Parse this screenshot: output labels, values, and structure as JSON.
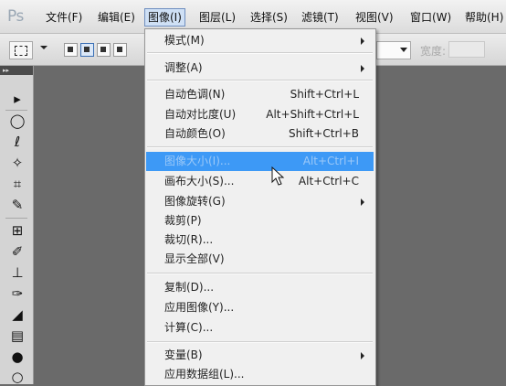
{
  "app": {
    "logo_text": "Ps"
  },
  "menubar": {
    "items": [
      {
        "label": "文件(F)"
      },
      {
        "label": "编辑(E)"
      },
      {
        "label": "图像(I)"
      },
      {
        "label": "图层(L)"
      },
      {
        "label": "选择(S)"
      },
      {
        "label": "滤镜(T)"
      },
      {
        "label": "视图(V)"
      },
      {
        "label": "窗口(W)"
      },
      {
        "label": "帮助(H)"
      }
    ],
    "active_index": 2
  },
  "options_bar": {
    "width_label": "宽度:"
  },
  "toolbox": {
    "collapse_glyph": "▸▸",
    "tools": [
      {
        "name": "move-tool-icon",
        "glyph": "▸"
      },
      {
        "name": "elliptical-marquee-tool-icon",
        "glyph": "◯"
      },
      {
        "name": "lasso-tool-icon",
        "glyph": "ℓ"
      },
      {
        "name": "magic-wand-tool-icon",
        "glyph": "✧"
      },
      {
        "name": "crop-tool-icon",
        "glyph": "⌗"
      },
      {
        "name": "eyedropper-tool-icon",
        "glyph": "✎"
      },
      {
        "name": "healing-brush-tool-icon",
        "glyph": "⊞"
      },
      {
        "name": "brush-tool-icon",
        "glyph": "✐"
      },
      {
        "name": "clone-stamp-tool-icon",
        "glyph": "⊥"
      },
      {
        "name": "history-brush-tool-icon",
        "glyph": "✑"
      },
      {
        "name": "eraser-tool-icon",
        "glyph": "◢"
      },
      {
        "name": "gradient-tool-icon",
        "glyph": "▤"
      },
      {
        "name": "blur-tool-icon",
        "glyph": "●"
      },
      {
        "name": "dodge-tool-icon",
        "glyph": "○"
      }
    ]
  },
  "image_menu": {
    "items": [
      {
        "label": "模式(M)",
        "shortcut": "",
        "submenu": true,
        "disabled": false
      },
      {
        "sep": true
      },
      {
        "label": "调整(A)",
        "shortcut": "",
        "submenu": true,
        "disabled": false
      },
      {
        "sep": true
      },
      {
        "label": "自动色调(N)",
        "shortcut": "Shift+Ctrl+L",
        "submenu": false,
        "disabled": false
      },
      {
        "label": "自动对比度(U)",
        "shortcut": "Alt+Shift+Ctrl+L",
        "submenu": false,
        "disabled": false
      },
      {
        "label": "自动颜色(O)",
        "shortcut": "Shift+Ctrl+B",
        "submenu": false,
        "disabled": false
      },
      {
        "sep": true
      },
      {
        "label": "图像大小(I)...",
        "shortcut": "Alt+Ctrl+I",
        "submenu": false,
        "disabled": false,
        "highlighted": true
      },
      {
        "label": "画布大小(S)...",
        "shortcut": "Alt+Ctrl+C",
        "submenu": false,
        "disabled": false
      },
      {
        "label": "图像旋转(G)",
        "shortcut": "",
        "submenu": true,
        "disabled": false
      },
      {
        "label": "裁剪(P)",
        "shortcut": "",
        "submenu": false,
        "disabled": false
      },
      {
        "label": "裁切(R)...",
        "shortcut": "",
        "submenu": false,
        "disabled": false
      },
      {
        "label": "显示全部(V)",
        "shortcut": "",
        "submenu": false,
        "disabled": false
      },
      {
        "sep": true
      },
      {
        "label": "复制(D)...",
        "shortcut": "",
        "submenu": false,
        "disabled": false
      },
      {
        "label": "应用图像(Y)...",
        "shortcut": "",
        "submenu": false,
        "disabled": false
      },
      {
        "label": "计算(C)...",
        "shortcut": "",
        "submenu": false,
        "disabled": false
      },
      {
        "sep": true
      },
      {
        "label": "变量(B)",
        "shortcut": "",
        "submenu": true,
        "disabled": false
      },
      {
        "label": "应用数据组(L)...",
        "shortcut": "",
        "submenu": false,
        "disabled": false
      }
    ]
  }
}
